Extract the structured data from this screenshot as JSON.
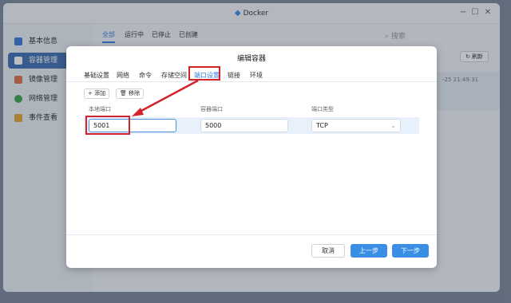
{
  "window": {
    "title": "Docker"
  },
  "sidebar": {
    "items": [
      {
        "label": "基本信息",
        "icon": "overview-icon",
        "color": "#3a7bd5"
      },
      {
        "label": "容器管理",
        "icon": "container-icon",
        "color": "#ffffff"
      },
      {
        "label": "镜像管理",
        "icon": "image-icon",
        "color": "#e0704a"
      },
      {
        "label": "网络管理",
        "icon": "network-icon",
        "color": "#3ca84a"
      },
      {
        "label": "事件查看",
        "icon": "event-icon",
        "color": "#e8a530"
      }
    ]
  },
  "main": {
    "filters": [
      "全部",
      "运行中",
      "已停止",
      "已创建"
    ],
    "search_placeholder": "搜索",
    "refresh_label": "刷新",
    "bg_time": "-25 21:49:31"
  },
  "dialog": {
    "title": "编辑容器",
    "tabs": [
      "基础设置",
      "网络",
      "命令",
      "存储空间",
      "端口设置",
      "链接",
      "环境"
    ],
    "active_tab": "端口设置",
    "add_label": "添加",
    "remove_label": "移除",
    "columns": [
      "本地端口",
      "容器端口",
      "端口类型"
    ],
    "row": {
      "local_port": "5001",
      "container_port": "5000",
      "type": "TCP"
    },
    "cancel_label": "取消",
    "prev_label": "上一步",
    "next_label": "下一步"
  },
  "colors": {
    "accent": "#3a8ee6",
    "callout": "#d2232a"
  }
}
